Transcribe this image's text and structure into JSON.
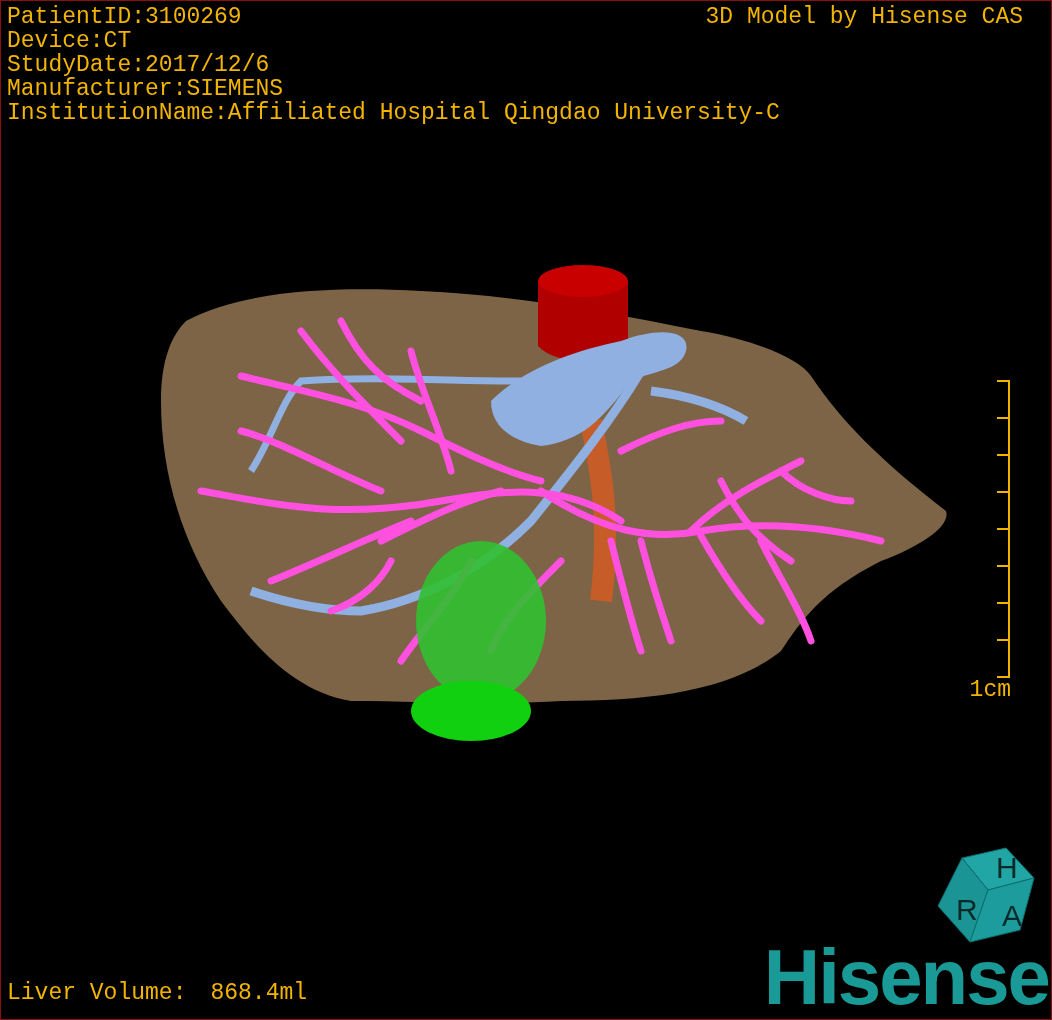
{
  "info_lines": [
    "PatientID:3100269",
    "Device:CT",
    "StudyDate:2017/12/6",
    "Manufacturer:SIEMENS",
    "InstitutionName:Affiliated Hospital Qingdao University-C"
  ],
  "model_title": "3D Model by Hisense CAS",
  "scale": {
    "label": "1cm"
  },
  "cube": {
    "letters": [
      "H",
      "R",
      "A"
    ]
  },
  "volume": {
    "label": "Liver Volume:",
    "value": "868.4ml"
  },
  "logo": "Hisense"
}
